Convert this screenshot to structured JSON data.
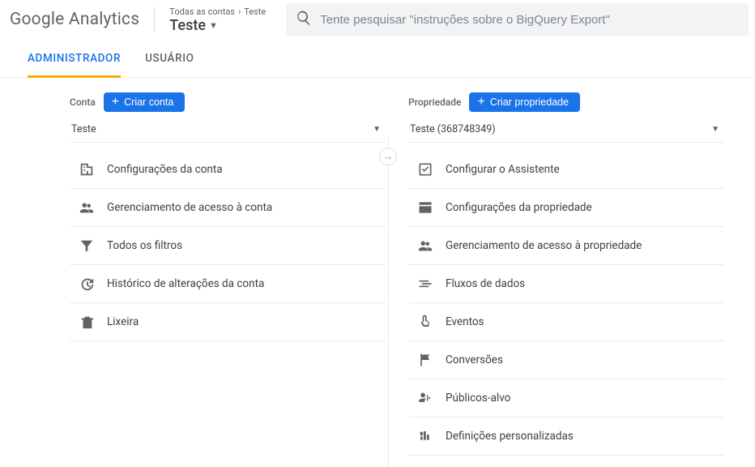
{
  "header": {
    "logo_a": "Google",
    "logo_b": "Analytics",
    "breadcrumb_all": "Todas as contas",
    "breadcrumb_target": "Teste",
    "property_name": "Teste",
    "search_placeholder": "Tente pesquisar \"instruções sobre o BigQuery Export\""
  },
  "tabs": {
    "admin": "ADMINISTRADOR",
    "user": "USUÁRIO"
  },
  "account": {
    "heading": "Conta",
    "create_btn": "Criar conta",
    "selected": "Teste",
    "items": [
      {
        "label": "Configurações da conta",
        "icon": "building"
      },
      {
        "label": "Gerenciamento de acesso à conta",
        "icon": "people"
      },
      {
        "label": "Todos os filtros",
        "icon": "filter"
      },
      {
        "label": "Histórico de alterações da conta",
        "icon": "history"
      },
      {
        "label": "Lixeira",
        "icon": "trash"
      }
    ]
  },
  "property": {
    "heading": "Propriedade",
    "create_btn": "Criar propriedade",
    "selected": "Teste (368748349)",
    "items": [
      {
        "label": "Configurar o Assistente",
        "icon": "checkbox"
      },
      {
        "label": "Configurações da propriedade",
        "icon": "layout"
      },
      {
        "label": "Gerenciamento de acesso à propriedade",
        "icon": "people"
      },
      {
        "label": "Fluxos de dados",
        "icon": "stream"
      },
      {
        "label": "Eventos",
        "icon": "tap"
      },
      {
        "label": "Conversões",
        "icon": "flag"
      },
      {
        "label": "Públicos-alvo",
        "icon": "audience"
      },
      {
        "label": "Definições personalizadas",
        "icon": "custom"
      }
    ]
  }
}
